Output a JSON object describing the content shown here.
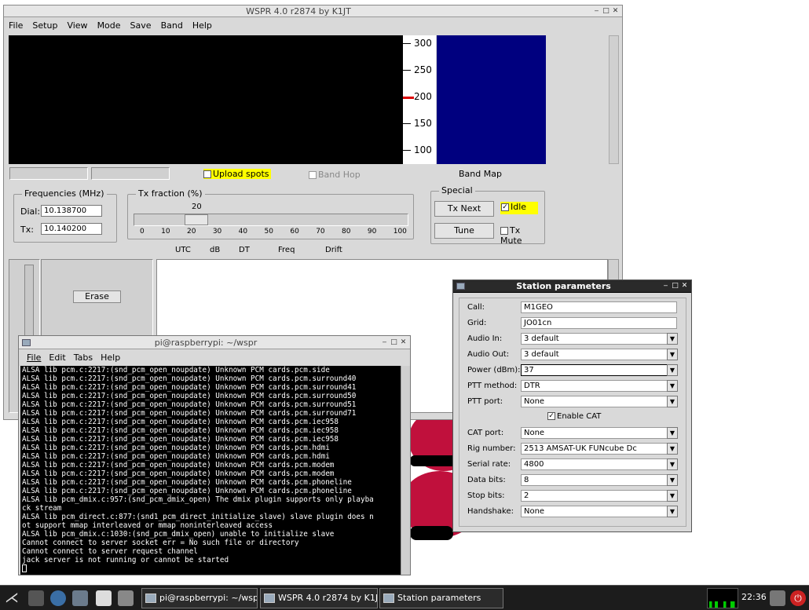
{
  "wspr": {
    "title": "WSPR 4.0 r2874    by K1JT",
    "menu": [
      "File",
      "Setup",
      "View",
      "Mode",
      "Save",
      "Band",
      "Help"
    ],
    "scale_ticks": [
      "300",
      "250",
      "200",
      "150",
      "100"
    ],
    "upload_spots_label": "Upload spots",
    "band_hop_label": "Band Hop",
    "band_map_label": "Band Map",
    "frequencies": {
      "group_title": "Frequencies (MHz)",
      "dial_label": "Dial:",
      "dial_value": "10.138700",
      "tx_label": "Tx:",
      "tx_value": "10.140200"
    },
    "tx_fraction": {
      "group_title": "Tx fraction (%)",
      "value": "20",
      "ticks": [
        "0",
        "10",
        "20",
        "30",
        "40",
        "50",
        "60",
        "70",
        "80",
        "90",
        "100"
      ]
    },
    "special": {
      "group_title": "Special",
      "tx_next_label": "Tx Next",
      "idle_label": "Idle",
      "tune_label": "Tune",
      "tx_mute_label": "Tx Mute"
    },
    "columns": [
      "UTC",
      "dB",
      "DT",
      "Freq",
      "Drift"
    ],
    "erase_label": "Erase",
    "colors": {
      "band_map": "#00007f",
      "highlight": "#ffff00"
    }
  },
  "terminal": {
    "title": "pi@raspberrypi: ~/wspr",
    "menu": [
      "File",
      "Edit",
      "Tabs",
      "Help"
    ],
    "lines": [
      "ALSA lib pcm.c:2217:(snd_pcm_open_noupdate) Unknown PCM cards.pcm.side",
      "ALSA lib pcm.c:2217:(snd_pcm_open_noupdate) Unknown PCM cards.pcm.surround40",
      "ALSA lib pcm.c:2217:(snd_pcm_open_noupdate) Unknown PCM cards.pcm.surround41",
      "ALSA lib pcm.c:2217:(snd_pcm_open_noupdate) Unknown PCM cards.pcm.surround50",
      "ALSA lib pcm.c:2217:(snd_pcm_open_noupdate) Unknown PCM cards.pcm.surround51",
      "ALSA lib pcm.c:2217:(snd_pcm_open_noupdate) Unknown PCM cards.pcm.surround71",
      "ALSA lib pcm.c:2217:(snd_pcm_open_noupdate) Unknown PCM cards.pcm.iec958",
      "ALSA lib pcm.c:2217:(snd_pcm_open_noupdate) Unknown PCM cards.pcm.iec958",
      "ALSA lib pcm.c:2217:(snd_pcm_open_noupdate) Unknown PCM cards.pcm.iec958",
      "ALSA lib pcm.c:2217:(snd_pcm_open_noupdate) Unknown PCM cards.pcm.hdmi",
      "ALSA lib pcm.c:2217:(snd_pcm_open_noupdate) Unknown PCM cards.pcm.hdmi",
      "ALSA lib pcm.c:2217:(snd_pcm_open_noupdate) Unknown PCM cards.pcm.modem",
      "ALSA lib pcm.c:2217:(snd_pcm_open_noupdate) Unknown PCM cards.pcm.modem",
      "ALSA lib pcm.c:2217:(snd_pcm_open_noupdate) Unknown PCM cards.pcm.phoneline",
      "ALSA lib pcm.c:2217:(snd_pcm_open_noupdate) Unknown PCM cards.pcm.phoneline",
      "ALSA lib pcm_dmix.c:957:(snd_pcm_dmix_open) The dmix plugin supports only playba",
      "ck stream",
      "ALSA lib pcm_direct.c:877:(snd1_pcm_direct_initialize_slave) slave plugin does n",
      "ot support mmap interleaved or mmap noninterleaved access",
      "ALSA lib pcm_dmix.c:1030:(snd_pcm_dmix_open) unable to initialize slave",
      "Cannot connect to server socket err = No such file or directory",
      "Cannot connect to server request channel",
      "jack server is not running or cannot be started",
      ""
    ]
  },
  "station": {
    "title": "Station parameters",
    "rows": [
      {
        "label": "Call:",
        "value": "M1GEO",
        "combo": false
      },
      {
        "label": "Grid:",
        "value": "JO01cn",
        "combo": false
      },
      {
        "label": "Audio In:",
        "value": "3 default",
        "combo": true
      },
      {
        "label": "Audio Out:",
        "value": "3 default",
        "combo": true
      },
      {
        "label": "Power (dBm):",
        "value": "37",
        "combo": true
      },
      {
        "label": "PTT method:",
        "value": "DTR",
        "combo": true
      },
      {
        "label": "PTT port:",
        "value": "None",
        "combo": true
      },
      {
        "label": "CAT port:",
        "value": "None",
        "combo": true
      },
      {
        "label": "Rig number:",
        "value": "2513  AMSAT-UK           FUNcube Dc",
        "combo": true
      },
      {
        "label": "Serial rate:",
        "value": "4800",
        "combo": true
      },
      {
        "label": "Data bits:",
        "value": "8",
        "combo": true
      },
      {
        "label": "Stop bits:",
        "value": "2",
        "combo": true
      },
      {
        "label": "Handshake:",
        "value": "None",
        "combo": true
      }
    ],
    "enable_cat_label": "Enable CAT"
  },
  "taskbar": {
    "tasks": [
      {
        "label": "pi@raspberrypi: ~/wspr"
      },
      {
        "label": "WSPR 4.0 r2874    by K1JT"
      },
      {
        "label": "Station parameters"
      }
    ],
    "clock": "22:36"
  }
}
